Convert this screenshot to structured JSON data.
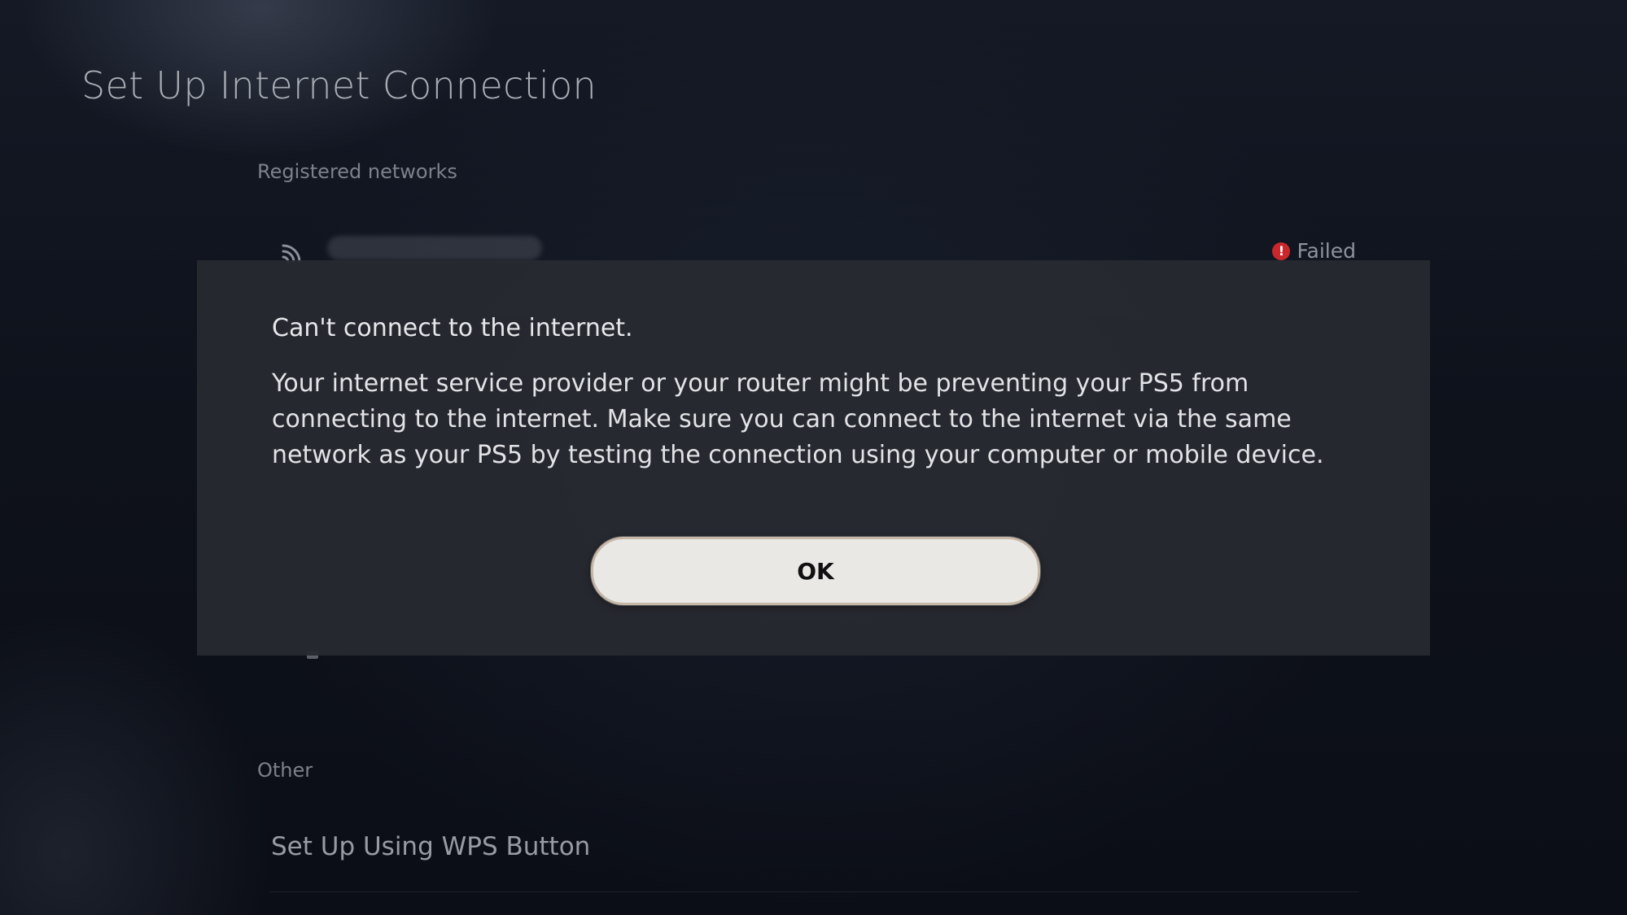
{
  "page": {
    "title": "Set Up Internet Connection"
  },
  "registered": {
    "label": "Registered networks",
    "network": {
      "icon": "wifi-icon",
      "status_icon": "error-icon",
      "status": "Failed"
    }
  },
  "other": {
    "label": "Other",
    "wps_label": "Set Up Using WPS Button"
  },
  "dialog": {
    "title": "Can't connect to the internet.",
    "body": "Your internet service provider or your router might be preventing your PS5 from connecting to the internet. Make sure you can connect to the internet via the same network as your PS5 by testing the connection using your computer or mobile device.",
    "ok_label": "OK"
  },
  "colors": {
    "error": "#c8282c",
    "dialog_bg": "#28292f",
    "button_bg": "#e9e8e5"
  }
}
